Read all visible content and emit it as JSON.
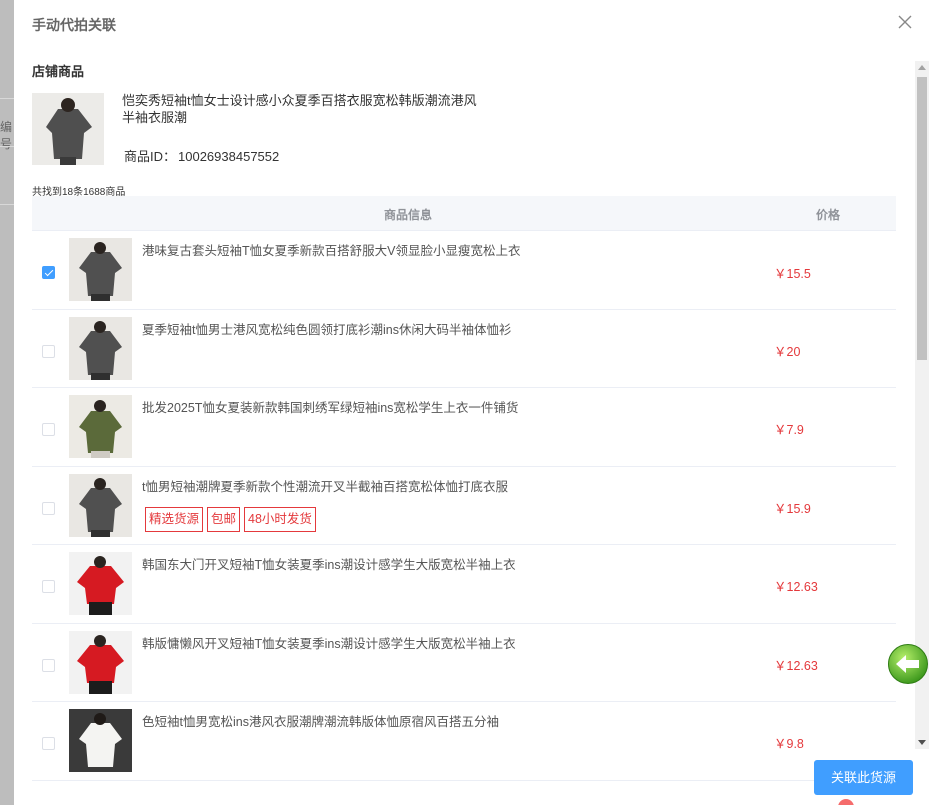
{
  "dialog": {
    "title": "手动代拍关联",
    "confirm_label": "关联此货源"
  },
  "backdrop": {
    "partial_text": "编号"
  },
  "store": {
    "section_title": "店铺商品",
    "name": "恺奕秀短袖t恤女士设计感小众夏季百搭衣服宽松韩版潮流港风半袖衣服潮",
    "id_label": "商品ID：",
    "id_value": "10026938457552"
  },
  "found_count": "共找到18条1688商品",
  "table": {
    "header_info": "商品信息",
    "header_price": "价格",
    "rows": [
      {
        "title": "港味复古套头短袖T恤女夏季新款百搭舒服大V领显脸小显瘦宽松上衣",
        "price": "￥15.5",
        "checked": true,
        "tags": [],
        "img": "gray"
      },
      {
        "title": "夏季短袖t恤男士港风宽松纯色圆领打底衫潮ins休闲大码半袖体恤衫",
        "price": "￥20",
        "checked": false,
        "tags": [],
        "img": "gray"
      },
      {
        "title": "批发2025T恤女夏装新款韩国刺绣军绿短袖ins宽松学生上衣一件铺货",
        "price": "￥7.9",
        "checked": false,
        "tags": [],
        "img": "green"
      },
      {
        "title": "t恤男短袖潮牌夏季新款个性潮流开叉半截袖百搭宽松体恤打底衣服",
        "price": "￥15.9",
        "checked": false,
        "tags": [
          "精选货源",
          "包邮",
          "48小时发货"
        ],
        "img": "gray"
      },
      {
        "title": "韩国东大门开叉短袖T恤女装夏季ins潮设计感学生大版宽松半袖上衣",
        "price": "￥12.63",
        "checked": false,
        "tags": [],
        "img": "red"
      },
      {
        "title": "韩版慵懒风开叉短袖T恤女装夏季ins潮设计感学生大版宽松半袖上衣",
        "price": "￥12.63",
        "checked": false,
        "tags": [],
        "img": "red"
      },
      {
        "title": "色短袖t恤男宽松ins港风衣服潮牌潮流韩版体恤原宿风百搭五分袖",
        "price": "￥9.8",
        "checked": false,
        "tags": [],
        "img": "white"
      }
    ]
  },
  "colors": {
    "primary": "#409eff",
    "price_red": "#e4393c",
    "header_bg": "#f5f7fa",
    "back_button": "#5cb82e"
  }
}
